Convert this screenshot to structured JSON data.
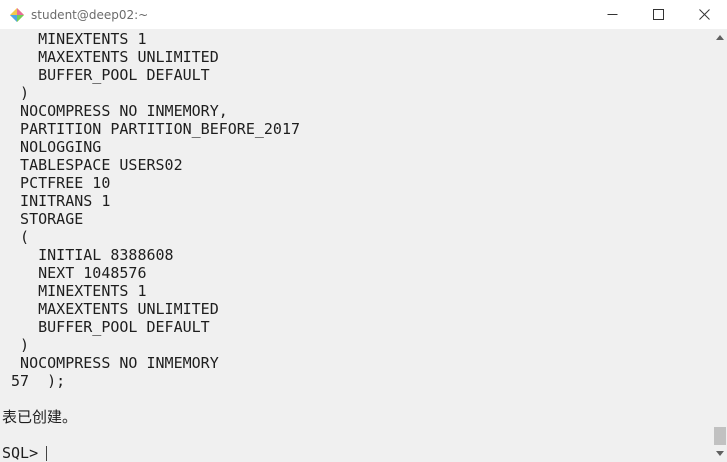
{
  "window": {
    "title": "student@deep02:~"
  },
  "terminal": {
    "lines": [
      "    MINEXTENTS 1",
      "    MAXEXTENTS UNLIMITED",
      "    BUFFER_POOL DEFAULT",
      "  )",
      "  NOCOMPRESS NO INMEMORY,",
      "  PARTITION PARTITION_BEFORE_2017",
      "  NOLOGGING",
      "  TABLESPACE USERS02",
      "  PCTFREE 10",
      "  INITRANS 1",
      "  STORAGE",
      "  (",
      "    INITIAL 8388608",
      "    NEXT 1048576",
      "    MINEXTENTS 1",
      "    MAXEXTENTS UNLIMITED",
      "    BUFFER_POOL DEFAULT",
      "  )",
      "  NOCOMPRESS NO INMEMORY",
      " 57  );",
      "",
      "表已创建。",
      ""
    ],
    "prompt": "SQL>"
  },
  "colors": {
    "terminal_bg": "#f0f0f0",
    "text": "#1e1e1e",
    "titlebar_bg": "#ffffff"
  },
  "icons": {
    "app": "putty-diamond-icon",
    "minimize": "minimize-icon",
    "maximize": "maximize-icon",
    "close": "close-icon"
  }
}
